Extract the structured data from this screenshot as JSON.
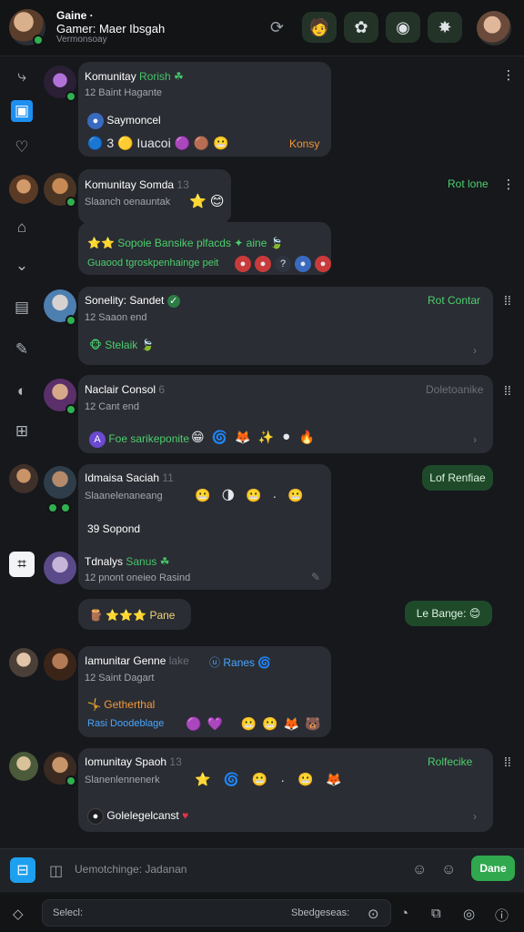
{
  "header": {
    "title": "Gaine ·",
    "subtitle": "Gamer: Maer Ibsgah",
    "meta": "Vermonsoay",
    "buttons": [
      "person-icon",
      "brain-icon",
      "hamster-icon",
      "puzzle-icon"
    ]
  },
  "rail": [
    "link-icon",
    "active-app-icon",
    "heart-icon",
    "folder-icon",
    "chevron-down-icon",
    "list-icon",
    "wrench-icon",
    "toggle-icon",
    "grid-icon"
  ],
  "messages": [
    {
      "name": "Komunitay",
      "name_tag": "Rorish ☘",
      "time": "12 Baint Hagante",
      "line": "Saymoncel",
      "emojis": "🔵 3 🟡 Iuacoi 🟣 🟤 😬",
      "right_inline": "Konsy",
      "right_label": ""
    },
    {
      "name": "Komunitay Somda",
      "name_num": "13",
      "time": "Slaanch oenauntak",
      "stars": "⭐ 😊",
      "line1": "⭐⭐ Sopoie  Bansike  plfacds ✦  aine 🍃",
      "line2": "Guaood tgroskpenhainge  peit",
      "right_label": "Rot lone"
    },
    {
      "name": "Sonelity: Sandet",
      "time": "12 Saaon end",
      "line": "Stelaik",
      "right_label": "Rot Contar"
    },
    {
      "name": "Naclair Consol",
      "name_num": "6",
      "time": "12 Cant end",
      "line": "Foe sarikeponite",
      "right_label": "Doletoanike"
    },
    {
      "name": "Idmaisa Saciah",
      "name_num": "11",
      "time": "Slaanelenaneang",
      "line": "39 Sopond",
      "pill": "Lof Renfiae"
    },
    {
      "name": "Tdnalys",
      "name_tag": "Sanus ☘",
      "time": "12 pnont oneieo Rasind",
      "line": "⭐⭐⭐ Pane",
      "pill": "Le Bange: 😊"
    },
    {
      "name": "Iamunitar Genne",
      "name_num": "lake",
      "name_tag": "Ranes",
      "time": "12 Saint Dagart",
      "line1": "Getherthal",
      "line2": "Rasi Doodeblage"
    },
    {
      "name": "Iomunitay Spaoh",
      "name_num": "13",
      "time": "Slanenlennenerk",
      "line": "Golelegelcanst",
      "right_label": "Rolfecike"
    }
  ],
  "composer": {
    "placeholder": "Uemotchinge: Jadanan",
    "send_label": "Dane"
  },
  "bottombar": {
    "select_label": "Selecl:",
    "status_label": "Sbedgeseas:"
  },
  "colors": {
    "accent_green": "#2fa84e",
    "accent_blue": "#1ea0f0",
    "bubble": "#2a2d33",
    "background": "#16181c"
  }
}
